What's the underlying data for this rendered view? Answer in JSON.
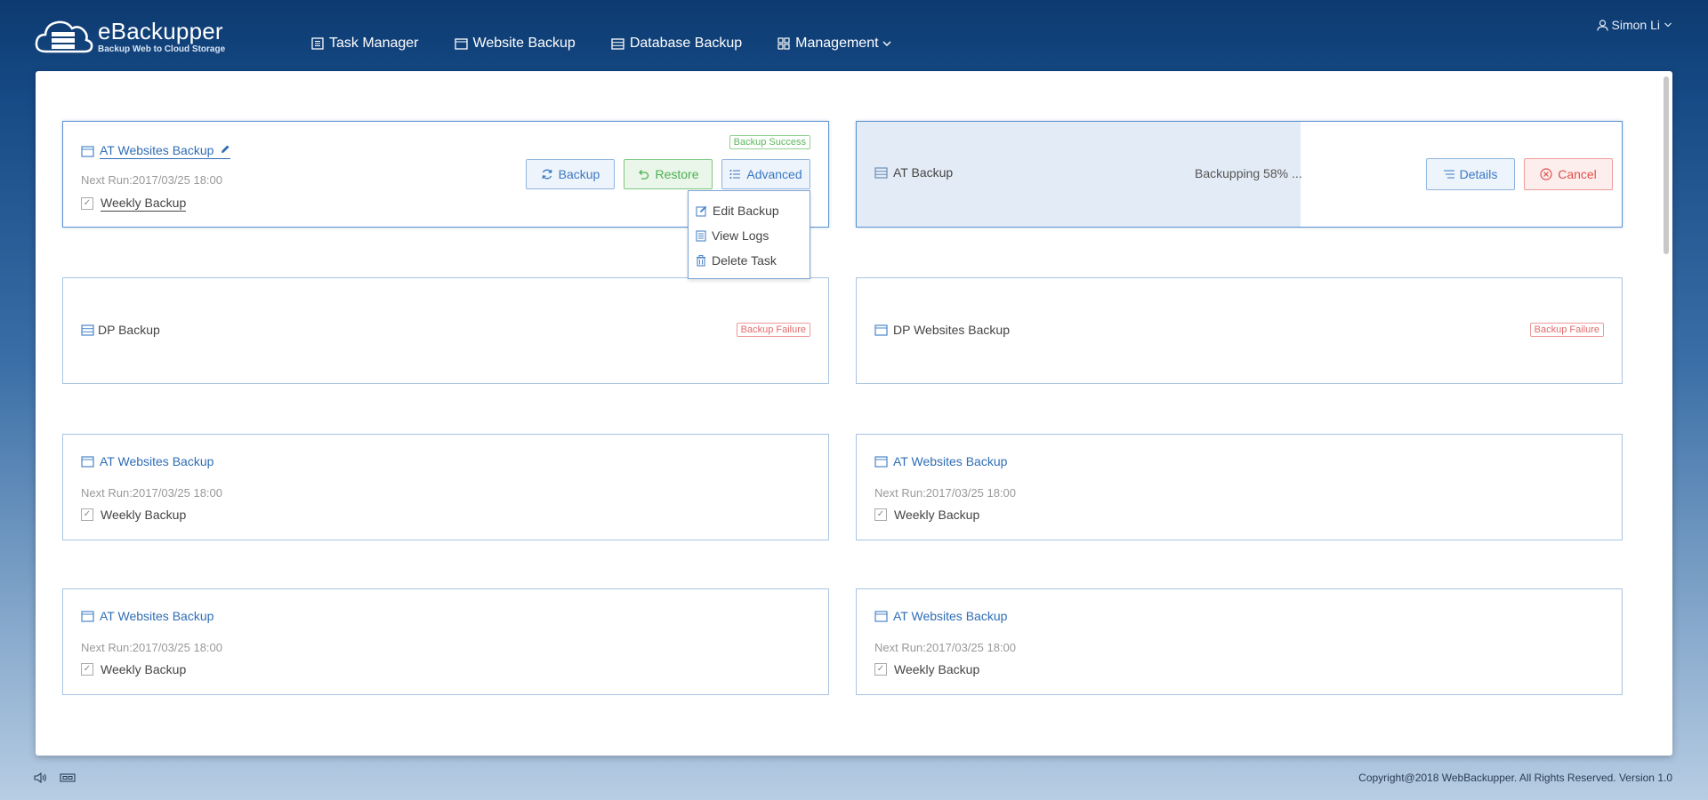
{
  "app": {
    "title": "eBackupper",
    "subtitle": "Backup Web to Cloud Storage"
  },
  "nav": [
    {
      "label": "Task Manager",
      "icon": "task-list-icon"
    },
    {
      "label": "Website Backup",
      "icon": "window-icon"
    },
    {
      "label": "Database Backup",
      "icon": "database-icon"
    },
    {
      "label": "Management",
      "icon": "grid-icon"
    }
  ],
  "user": {
    "name": "Simon Li"
  },
  "cards": {
    "c1": {
      "title": "AT Websites Backup",
      "next_run": "Next Run:2017/03/25 18:00",
      "schedule": "Weekly Backup",
      "badge": "Backup Success",
      "buttons": {
        "backup": "Backup",
        "restore": "Restore",
        "advanced": "Advanced"
      },
      "menu": [
        "Edit Backup",
        "View Logs",
        "Delete Task"
      ]
    },
    "c2": {
      "title": "AT Backup",
      "progress_text": "Backupping 58% ...",
      "progress": 0.58,
      "buttons": {
        "details": "Details",
        "cancel": "Cancel"
      }
    },
    "c3": {
      "title": "DP Backup",
      "badge": "Backup Failure"
    },
    "c4": {
      "title": "DP Websites Backup",
      "badge": "Backup Failure"
    },
    "c5": {
      "title": "AT Websites Backup",
      "next_run": "Next Run:2017/03/25 18:00",
      "schedule": "Weekly Backup"
    },
    "c6": {
      "title": "AT Websites Backup",
      "next_run": "Next Run:2017/03/25 18:00",
      "schedule": "Weekly Backup"
    },
    "c7": {
      "title": "AT Websites Backup",
      "next_run": "Next Run:2017/03/25 18:00",
      "schedule": "Weekly Backup"
    },
    "c8": {
      "title": "AT Websites Backup",
      "next_run": "Next Run:2017/03/25 18:00",
      "schedule": "Weekly Backup"
    }
  },
  "footer": {
    "copyright": "Copyright@2018 WebBackupper. All Rights Reserved. Version 1.0"
  },
  "colors": {
    "accent": "#2f6db5",
    "success": "#5cb85c",
    "failure": "#e26b6b"
  }
}
